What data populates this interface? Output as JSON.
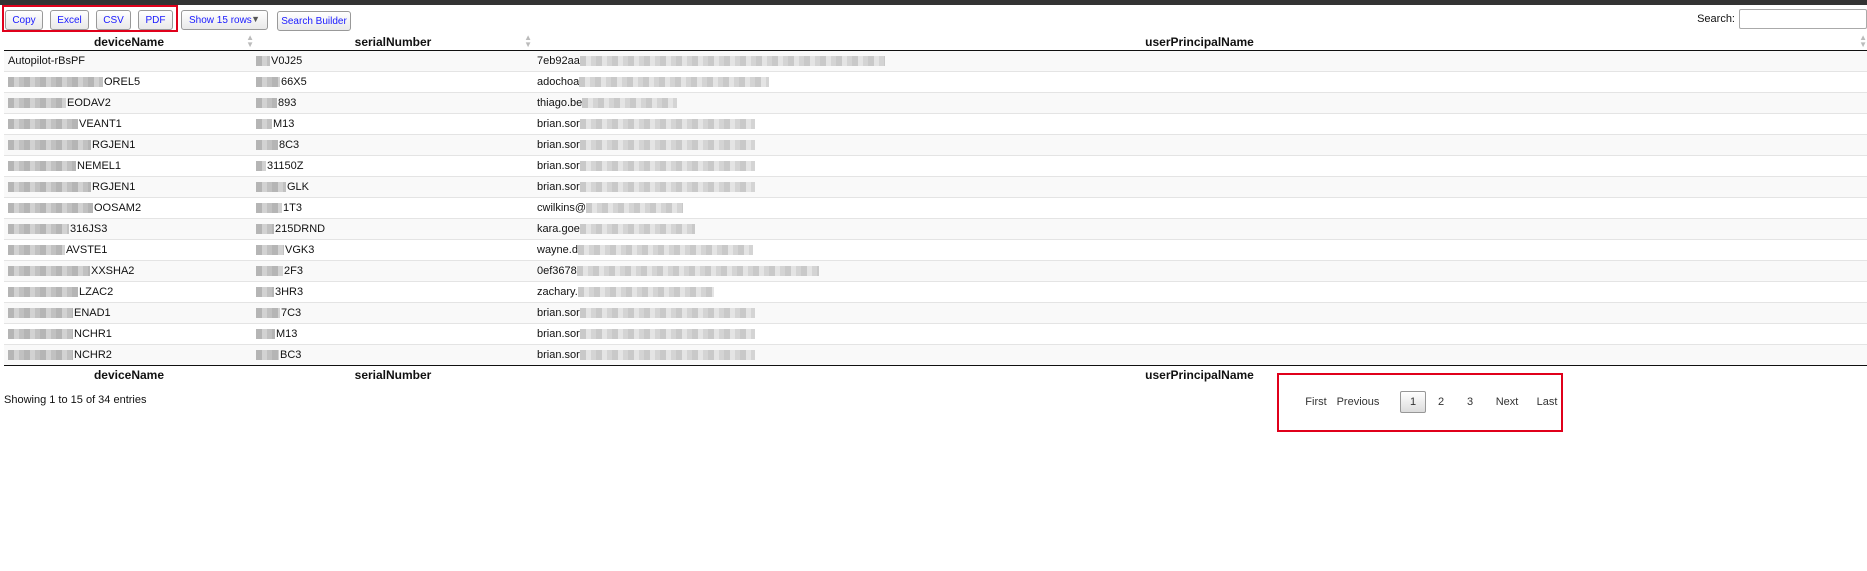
{
  "toolbar": {
    "copy": "Copy",
    "excel": "Excel",
    "csv": "CSV",
    "pdf": "PDF",
    "rows": "Show 15 rows",
    "builder": "Search Builder"
  },
  "search": {
    "label": "Search:",
    "value": ""
  },
  "columns": [
    "deviceName",
    "serialNumber",
    "userPrincipalName"
  ],
  "rows": [
    {
      "device": "Autopilot-rBsPF",
      "serial": "V0J25",
      "upn": "7eb92aa"
    },
    {
      "device": "OREL5",
      "serial": "66X5",
      "upn": "adochoa"
    },
    {
      "device": "EODAV2",
      "serial": "893",
      "upn": "thiago.be"
    },
    {
      "device": "VEANT1",
      "serial": "M13",
      "upn": "brian.sor"
    },
    {
      "device": "RGJEN1",
      "serial": "8C3",
      "upn": "brian.sor"
    },
    {
      "device": "NEMEL1",
      "serial": "31150Z",
      "upn": "brian.sor"
    },
    {
      "device": "RGJEN1",
      "serial": "GLK",
      "upn": "brian.sor"
    },
    {
      "device": "OOSAM2",
      "serial": "1T3",
      "upn": "cwilkins@"
    },
    {
      "device": "316JS3",
      "serial": "215DRND",
      "upn": "kara.goe"
    },
    {
      "device": "AVSTE1",
      "serial": "VGK3",
      "upn": "wayne.d"
    },
    {
      "device": "XXSHA2",
      "serial": "2F3",
      "upn": "0ef3678"
    },
    {
      "device": "LZAC2",
      "serial": "3HR3",
      "upn": "zachary."
    },
    {
      "device": "ENAD1",
      "serial": "7C3",
      "upn": "brian.sor"
    },
    {
      "device": "NCHR1",
      "serial": "M13",
      "upn": "brian.sor"
    },
    {
      "device": "NCHR2",
      "serial": "BC3",
      "upn": "brian.sor"
    }
  ],
  "info": "Showing 1 to 15 of 34 entries",
  "pagination": {
    "first": "First",
    "previous": "Previous",
    "pages": [
      "1",
      "2",
      "3"
    ],
    "current": "1",
    "next": "Next",
    "last": "Last"
  },
  "colors": {
    "highlight": "#e0001b",
    "button_text": "#1a1aff",
    "topbar": "#333333"
  },
  "icons": {
    "sort": "sort-both-icon",
    "dropdown": "caret-down-icon"
  }
}
